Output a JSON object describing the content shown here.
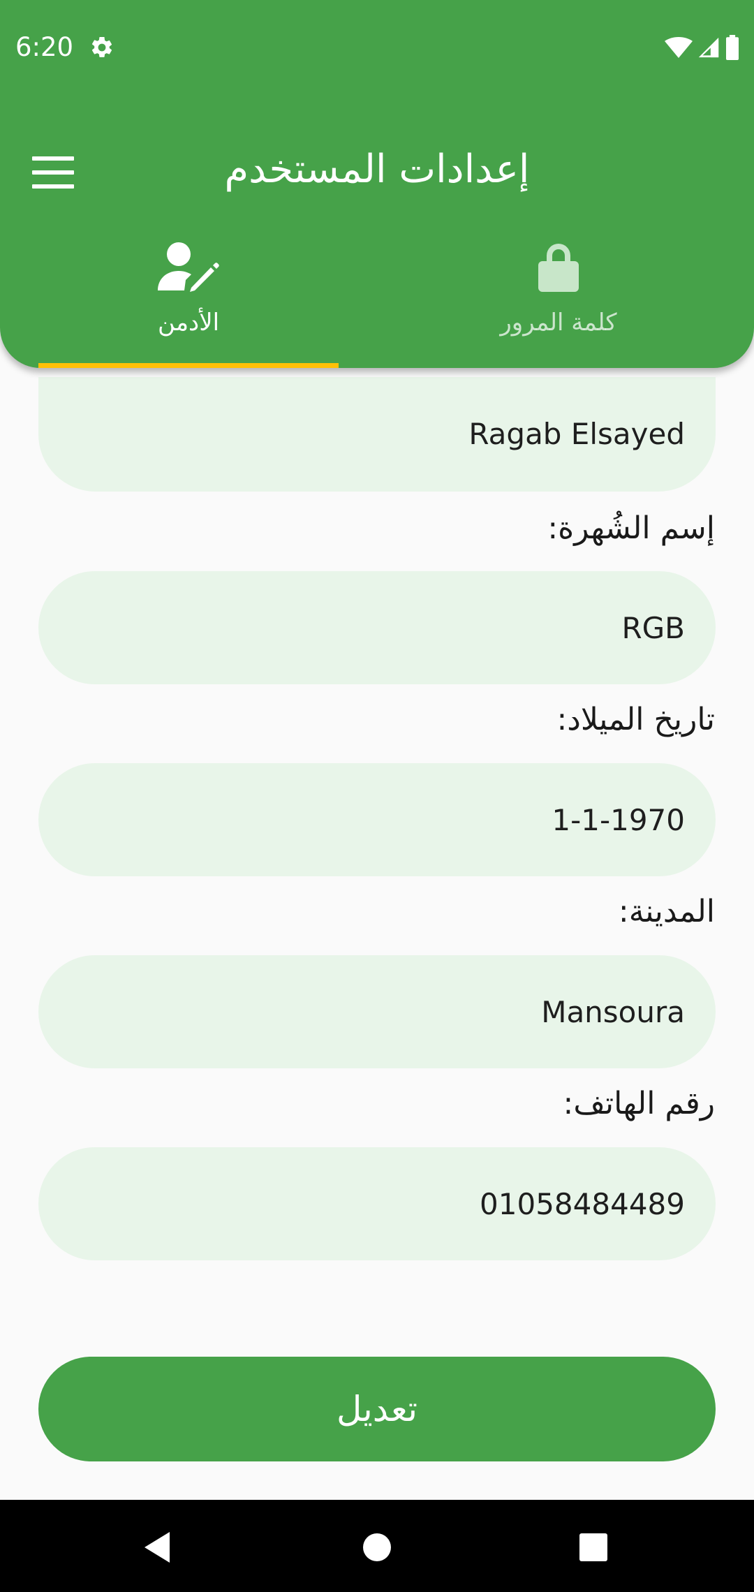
{
  "status_bar": {
    "time": "6:20",
    "icons": [
      "gear-icon",
      "wifi-icon",
      "signal-icon",
      "battery-icon"
    ]
  },
  "app_bar": {
    "title": "إعدادات المستخدم",
    "menu_icon": "menu-icon",
    "background_color": "#46a249"
  },
  "tabs": [
    {
      "label": "الأدمن",
      "icon": "user-edit-icon",
      "selected": true
    },
    {
      "label": "كلمة المرور",
      "icon": "lock-icon",
      "selected": false
    }
  ],
  "tab_indicator_color": "#ffc107",
  "form": {
    "name": {
      "value": "Ragab Elsayed"
    },
    "nickname": {
      "label": "إسم الشُهرة:",
      "value": "RGB"
    },
    "birthdate": {
      "label": "تاريخ الميلاد:",
      "value": "1-1-1970"
    },
    "city": {
      "label": "المدينة:",
      "value": "Mansoura"
    },
    "phone": {
      "label": "رقم الهاتف:",
      "value": "01058484489"
    }
  },
  "edit_button": {
    "label": "تعديل"
  },
  "field_background": "#e8f5e9",
  "nav_bar": {
    "icons": [
      "back-icon",
      "home-icon",
      "recents-icon"
    ]
  }
}
